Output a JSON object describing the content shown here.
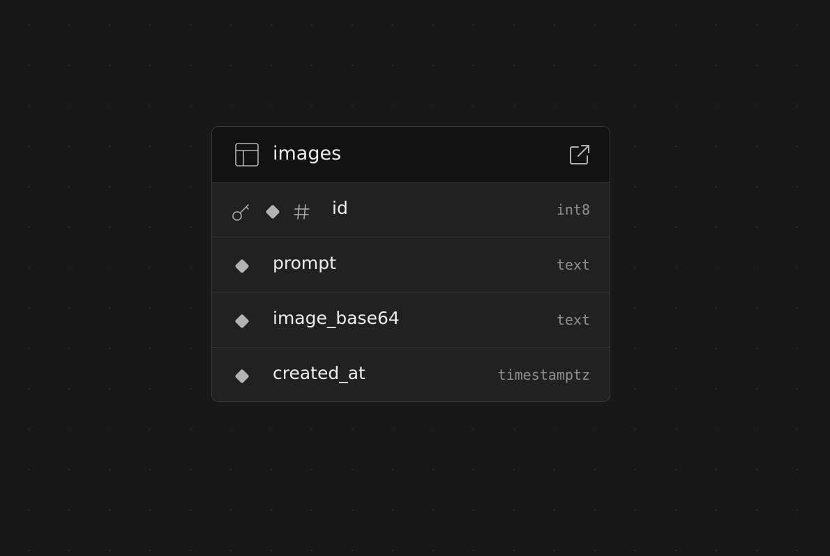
{
  "table": {
    "name": "images",
    "header_icon": "table-icon",
    "action_icon": "external-link-icon"
  },
  "columns": [
    {
      "name": "id",
      "type": "int8",
      "icons": [
        "key-icon",
        "diamond-icon",
        "hash-icon"
      ]
    },
    {
      "name": "prompt",
      "type": "text",
      "icons": [
        "diamond-icon"
      ]
    },
    {
      "name": "image_base64",
      "type": "text",
      "icons": [
        "diamond-icon"
      ]
    },
    {
      "name": "created_at",
      "type": "timestamptz",
      "icons": [
        "diamond-icon"
      ]
    }
  ],
  "colors": {
    "canvas_bg": "#181818",
    "node_bg": "#212121",
    "header_bg": "#121212",
    "text_primary": "#ededed",
    "text_muted": "#8f8f8f",
    "icon_fill": "#b3b3b3"
  }
}
